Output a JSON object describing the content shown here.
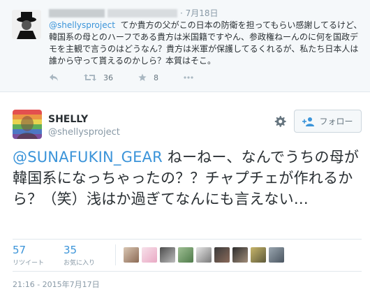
{
  "reply_tweet": {
    "date": "· 7月18日",
    "mention": "@shellysproject",
    "text": "てか貴方の父がこの日本の防衛を担ってもらい感謝してるけど、韓国系の母とのハーフである貴方は米国籍ですやん、参政権ねーんのに何を国政デモを主観で言うのはどうなん？貴方は米軍が保護してるくれるが、私たち日本人は誰から守って貰えるのかしら？本質はそこ。",
    "retweet_count": "36",
    "favorite_count": "8"
  },
  "main_tweet": {
    "name": "SHELLY",
    "handle": "@shellysproject",
    "follow_label": "フォロー",
    "mention": "@SUNAFUKIN_GEAR",
    "text": " ねーねー、なんでうちの母が韓国系になっちゃったの？？チャプチェが作れるから？（笑）浅はか過ぎてなんにも言えない…",
    "retweets": "57",
    "retweets_label": "リツイート",
    "favorites": "35",
    "favorites_label": "お気に入り",
    "timestamp": "21:16 - 2015年7月17日"
  },
  "colors": {
    "link": "#3b94d9",
    "text": "#292f33",
    "muted": "#8899a6"
  }
}
